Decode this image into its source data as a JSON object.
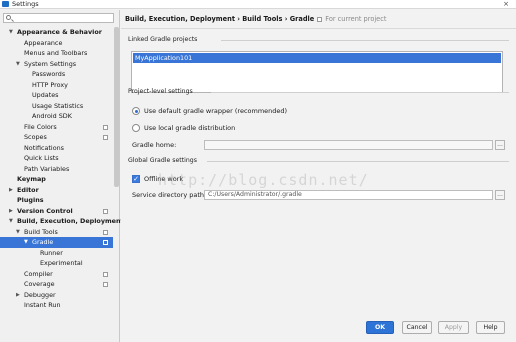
{
  "window": {
    "title": "Settings",
    "close_glyph": "×"
  },
  "sidebar": {
    "search_placeholder": "",
    "items": [
      {
        "label": "Appearance & Behavior",
        "bold": true,
        "expanded": true,
        "arrow": "▼",
        "level": 0
      },
      {
        "label": "Appearance",
        "level": 1
      },
      {
        "label": "Menus and Toolbars",
        "level": 1
      },
      {
        "label": "System Settings",
        "level": 1,
        "arrow": "▼"
      },
      {
        "label": "Passwords",
        "level": 2
      },
      {
        "label": "HTTP Proxy",
        "level": 2
      },
      {
        "label": "Updates",
        "level": 2
      },
      {
        "label": "Usage Statistics",
        "level": 2
      },
      {
        "label": "Android SDK",
        "level": 2
      },
      {
        "label": "File Colors",
        "level": 1,
        "project": true
      },
      {
        "label": "Scopes",
        "level": 1,
        "project": true
      },
      {
        "label": "Notifications",
        "level": 1
      },
      {
        "label": "Quick Lists",
        "level": 1
      },
      {
        "label": "Path Variables",
        "level": 1
      },
      {
        "label": "Keymap",
        "bold": true,
        "level": 0
      },
      {
        "label": "Editor",
        "bold": true,
        "level": 0,
        "arrow": "▶"
      },
      {
        "label": "Plugins",
        "bold": true,
        "level": 0
      },
      {
        "label": "Version Control",
        "bold": true,
        "level": 0,
        "arrow": "▶",
        "project": true
      },
      {
        "label": "Build, Execution, Deployment",
        "bold": true,
        "level": 0,
        "arrow": "▼"
      },
      {
        "label": "Build Tools",
        "level": 1,
        "arrow": "▼",
        "project": true
      },
      {
        "label": "Gradle",
        "level": 2,
        "arrow": "▼",
        "selected": true,
        "project": true
      },
      {
        "label": "Runner",
        "level": 3
      },
      {
        "label": "Experimental",
        "level": 3
      },
      {
        "label": "Compiler",
        "level": 1,
        "project": true
      },
      {
        "label": "Coverage",
        "level": 1,
        "project": true
      },
      {
        "label": "Debugger",
        "level": 1,
        "arrow": "▶"
      },
      {
        "label": "Instant Run",
        "level": 1
      }
    ]
  },
  "breadcrumb": {
    "path": "Build, Execution, Deployment › Build Tools › Gradle",
    "scope": "For current project"
  },
  "linked_projects": {
    "title": "Linked Gradle projects",
    "items": [
      "MyApplication101"
    ]
  },
  "project_level": {
    "title": "Project-level settings",
    "option_default": "Use default gradle wrapper (recommended)",
    "option_local": "Use local gradle distribution",
    "selected": "default",
    "gradle_home_label": "Gradle home:",
    "gradle_home_value": "",
    "browse_label": "..."
  },
  "global": {
    "title": "Global Gradle settings",
    "offline_label": "Offline work",
    "offline_checked": true,
    "service_dir_label": "Service directory path:",
    "service_dir_value": "C:/Users/Administrator/.gradle",
    "browse_label": "..."
  },
  "watermark": "http://blog.csdn.net/",
  "buttons": {
    "ok": "OK",
    "cancel": "Cancel",
    "apply": "Apply",
    "help": "Help"
  },
  "colors": {
    "selection": "#3875d7",
    "primary_button": "#2e74d6"
  }
}
